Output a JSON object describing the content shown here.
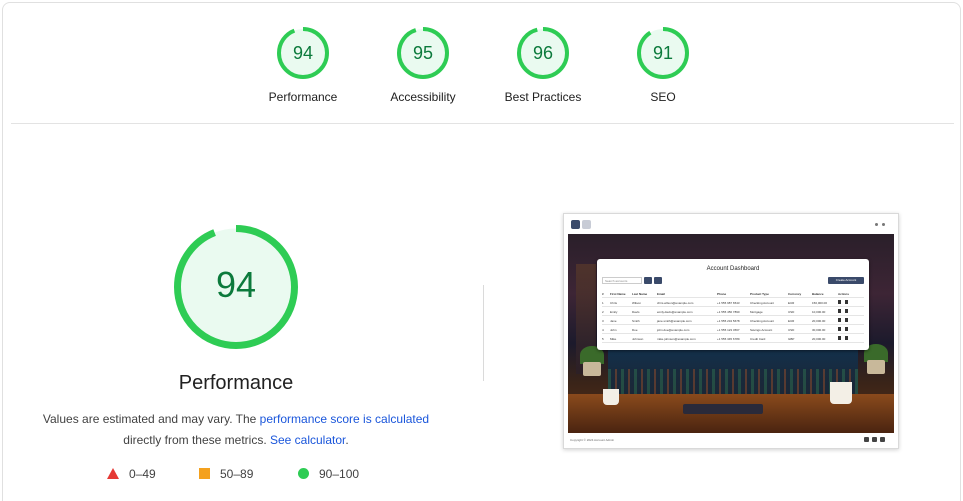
{
  "gauges": [
    {
      "label": "Performance",
      "score": "94",
      "value": 94
    },
    {
      "label": "Accessibility",
      "score": "95",
      "value": 95
    },
    {
      "label": "Best Practices",
      "score": "96",
      "value": 96
    },
    {
      "label": "SEO",
      "score": "91",
      "value": 91
    }
  ],
  "main": {
    "score": "94",
    "value": 94,
    "title": "Performance",
    "desc_prefix": "Values are estimated and may vary. The ",
    "desc_link1": "performance score is calculated",
    "desc_mid": " directly from these metrics. ",
    "desc_link2": "See calculator",
    "desc_suffix": "."
  },
  "legend": [
    {
      "icon": "fail-triangle-icon",
      "range": "0–49"
    },
    {
      "icon": "average-square-icon",
      "range": "50–89"
    },
    {
      "icon": "pass-circle-icon",
      "range": "90–100"
    }
  ],
  "screenshot": {
    "dashboard_title": "Account Dashboard",
    "search_placeholder": "Search accounts",
    "create_button": "Create Account",
    "columns": [
      "#",
      "First Name",
      "Last Name",
      "Email",
      "Phone",
      "Product Type",
      "Currency",
      "Balance",
      "Actions"
    ],
    "rows": [
      [
        "1",
        "Chris",
        "Wilson",
        "chris.wilson@example.com",
        "+1 555 987 6543",
        "Checking Account",
        "EUR",
        "150,000.00"
      ],
      [
        "2",
        "Emily",
        "Davis",
        "emily.davis@example.com",
        "+1 555 456 7890",
        "Mortgage",
        "USD",
        "10,000.00"
      ],
      [
        "3",
        "Jane",
        "Smith",
        "jane.smith@example.com",
        "+1 555 234 5678",
        "Checking Account",
        "EUR",
        "20,000.00"
      ],
      [
        "4",
        "John",
        "Doe",
        "john.doe@example.com",
        "+1 555 123 4567",
        "Savings Account",
        "USD",
        "30,000.00"
      ],
      [
        "5",
        "Mike",
        "Johnson",
        "mike.johnson@example.com",
        "+1 555 345 6789",
        "Credit Card",
        "GBP",
        "20,000.00"
      ]
    ],
    "footer": "Copyright © 2024 Account Admin"
  },
  "colors": {
    "pass": "#0c7a3c",
    "pass_ring": "#2ecc54",
    "pass_fill": "#eafaf0",
    "fail": "#e53935",
    "average": "#f4a11e",
    "link": "#1a56db"
  }
}
